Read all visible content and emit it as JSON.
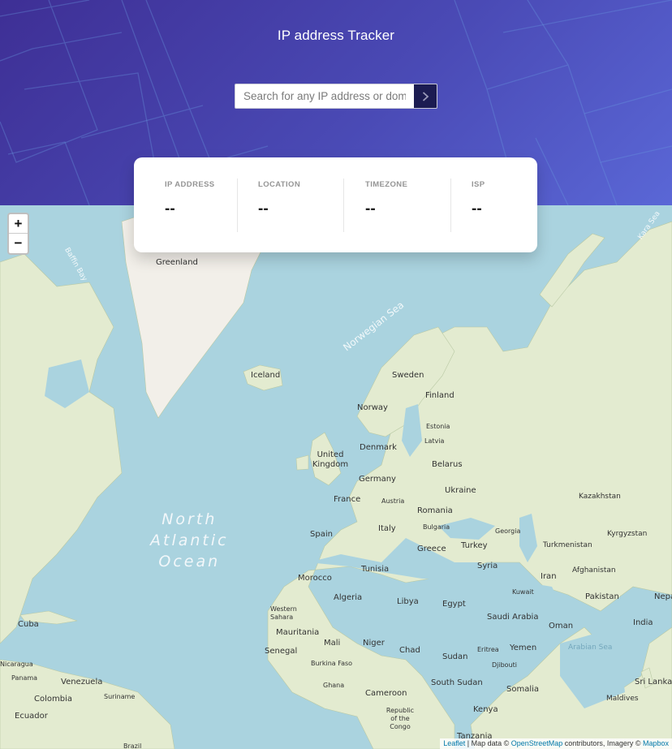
{
  "header": {
    "title": "IP address Tracker",
    "search": {
      "placeholder": "Search for any IP address or domain",
      "value": ""
    },
    "submit_icon": "chevron-right-icon"
  },
  "stats": [
    {
      "label": "IP ADDRESS",
      "value": "--"
    },
    {
      "label": "LOCATION",
      "value": "--"
    },
    {
      "label": "TIMEZONE",
      "value": "--"
    },
    {
      "label": "ISP",
      "value": "--"
    }
  ],
  "map": {
    "zoom_in": "+",
    "zoom_out": "−",
    "ocean": [
      "North",
      "Atlantic",
      "Ocean"
    ],
    "seas": [
      "Baffin Bay",
      "Norwegian Sea",
      "Kara Sea",
      "Arabian Sea"
    ],
    "labels": [
      "Greenland",
      "Iceland",
      "Sweden",
      "Finland",
      "Norway",
      "Estonia",
      "Latvia",
      "Denmark",
      "United Kingdom",
      "Belarus",
      "Germany",
      "Ukraine",
      "France",
      "Austria",
      "Romania",
      "Spain",
      "Italy",
      "Bulgaria",
      "Greece",
      "Turkey",
      "Georgia",
      "Kazakhstan",
      "Kyrgyzstan",
      "Turkmenistan",
      "Afghanistan",
      "Iran",
      "Syria",
      "Kuwait",
      "Pakistan",
      "Nepal",
      "India",
      "Tunisia",
      "Morocco",
      "Algeria",
      "Libya",
      "Egypt",
      "Saudi Arabia",
      "Oman",
      "Western Sahara",
      "Mauritania",
      "Mali",
      "Niger",
      "Chad",
      "Sudan",
      "Eritrea",
      "Yemen",
      "Djibouti",
      "Senegal",
      "Burkina Faso",
      "Ghana",
      "Cameroon",
      "South Sudan",
      "Somalia",
      "Kenya",
      "Tanzania",
      "Republic of the Congo",
      "Sri Lanka",
      "Maldives",
      "Cuba",
      "Venezuela",
      "Colombia",
      "Suriname",
      "Ecuador",
      "Panama",
      "Nicaragua",
      "Brazil"
    ],
    "attribution": {
      "leaflet": "Leaflet",
      "text1": " | Map data © ",
      "osm": "OpenStreetMap",
      "text2": " contributors, Imagery © ",
      "mapbox": "Mapbox"
    }
  },
  "colors": {
    "header_start": "#3e2f95",
    "header_end": "#5a67d6",
    "button": "#1c1c52",
    "water": "#aad3df",
    "land": "#e3ebd0",
    "ice": "#f2efe9"
  }
}
